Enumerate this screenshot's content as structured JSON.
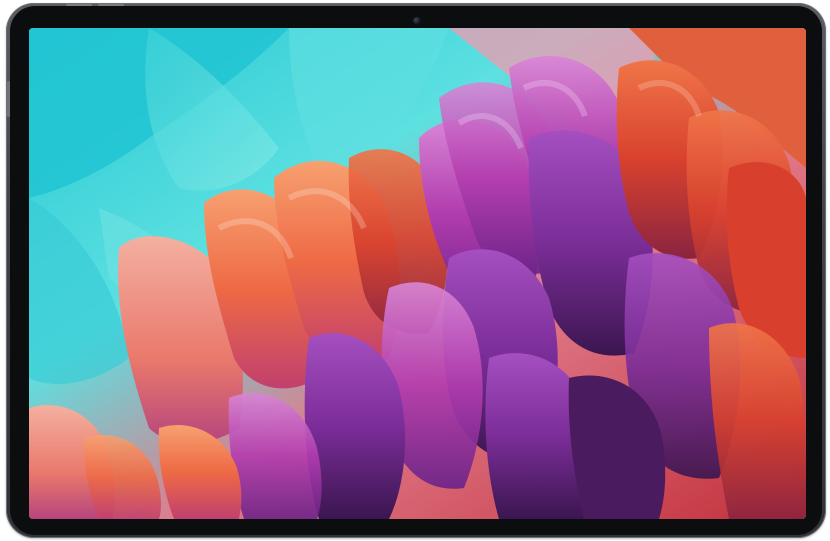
{
  "device": {
    "type": "tablet",
    "color": "#3f4247",
    "bezel_color": "#0c0d0f"
  },
  "wallpaper": {
    "subject": "abstract-feather-petals",
    "palette": {
      "teal": "#2ad0d6",
      "aqua": "#6fe6e4",
      "orange": "#f07a48",
      "coral": "#e85a55",
      "magenta": "#b43aa6",
      "purple": "#7a2f9c",
      "deep_purple": "#3e1a4f",
      "red": "#d23a2e"
    }
  }
}
